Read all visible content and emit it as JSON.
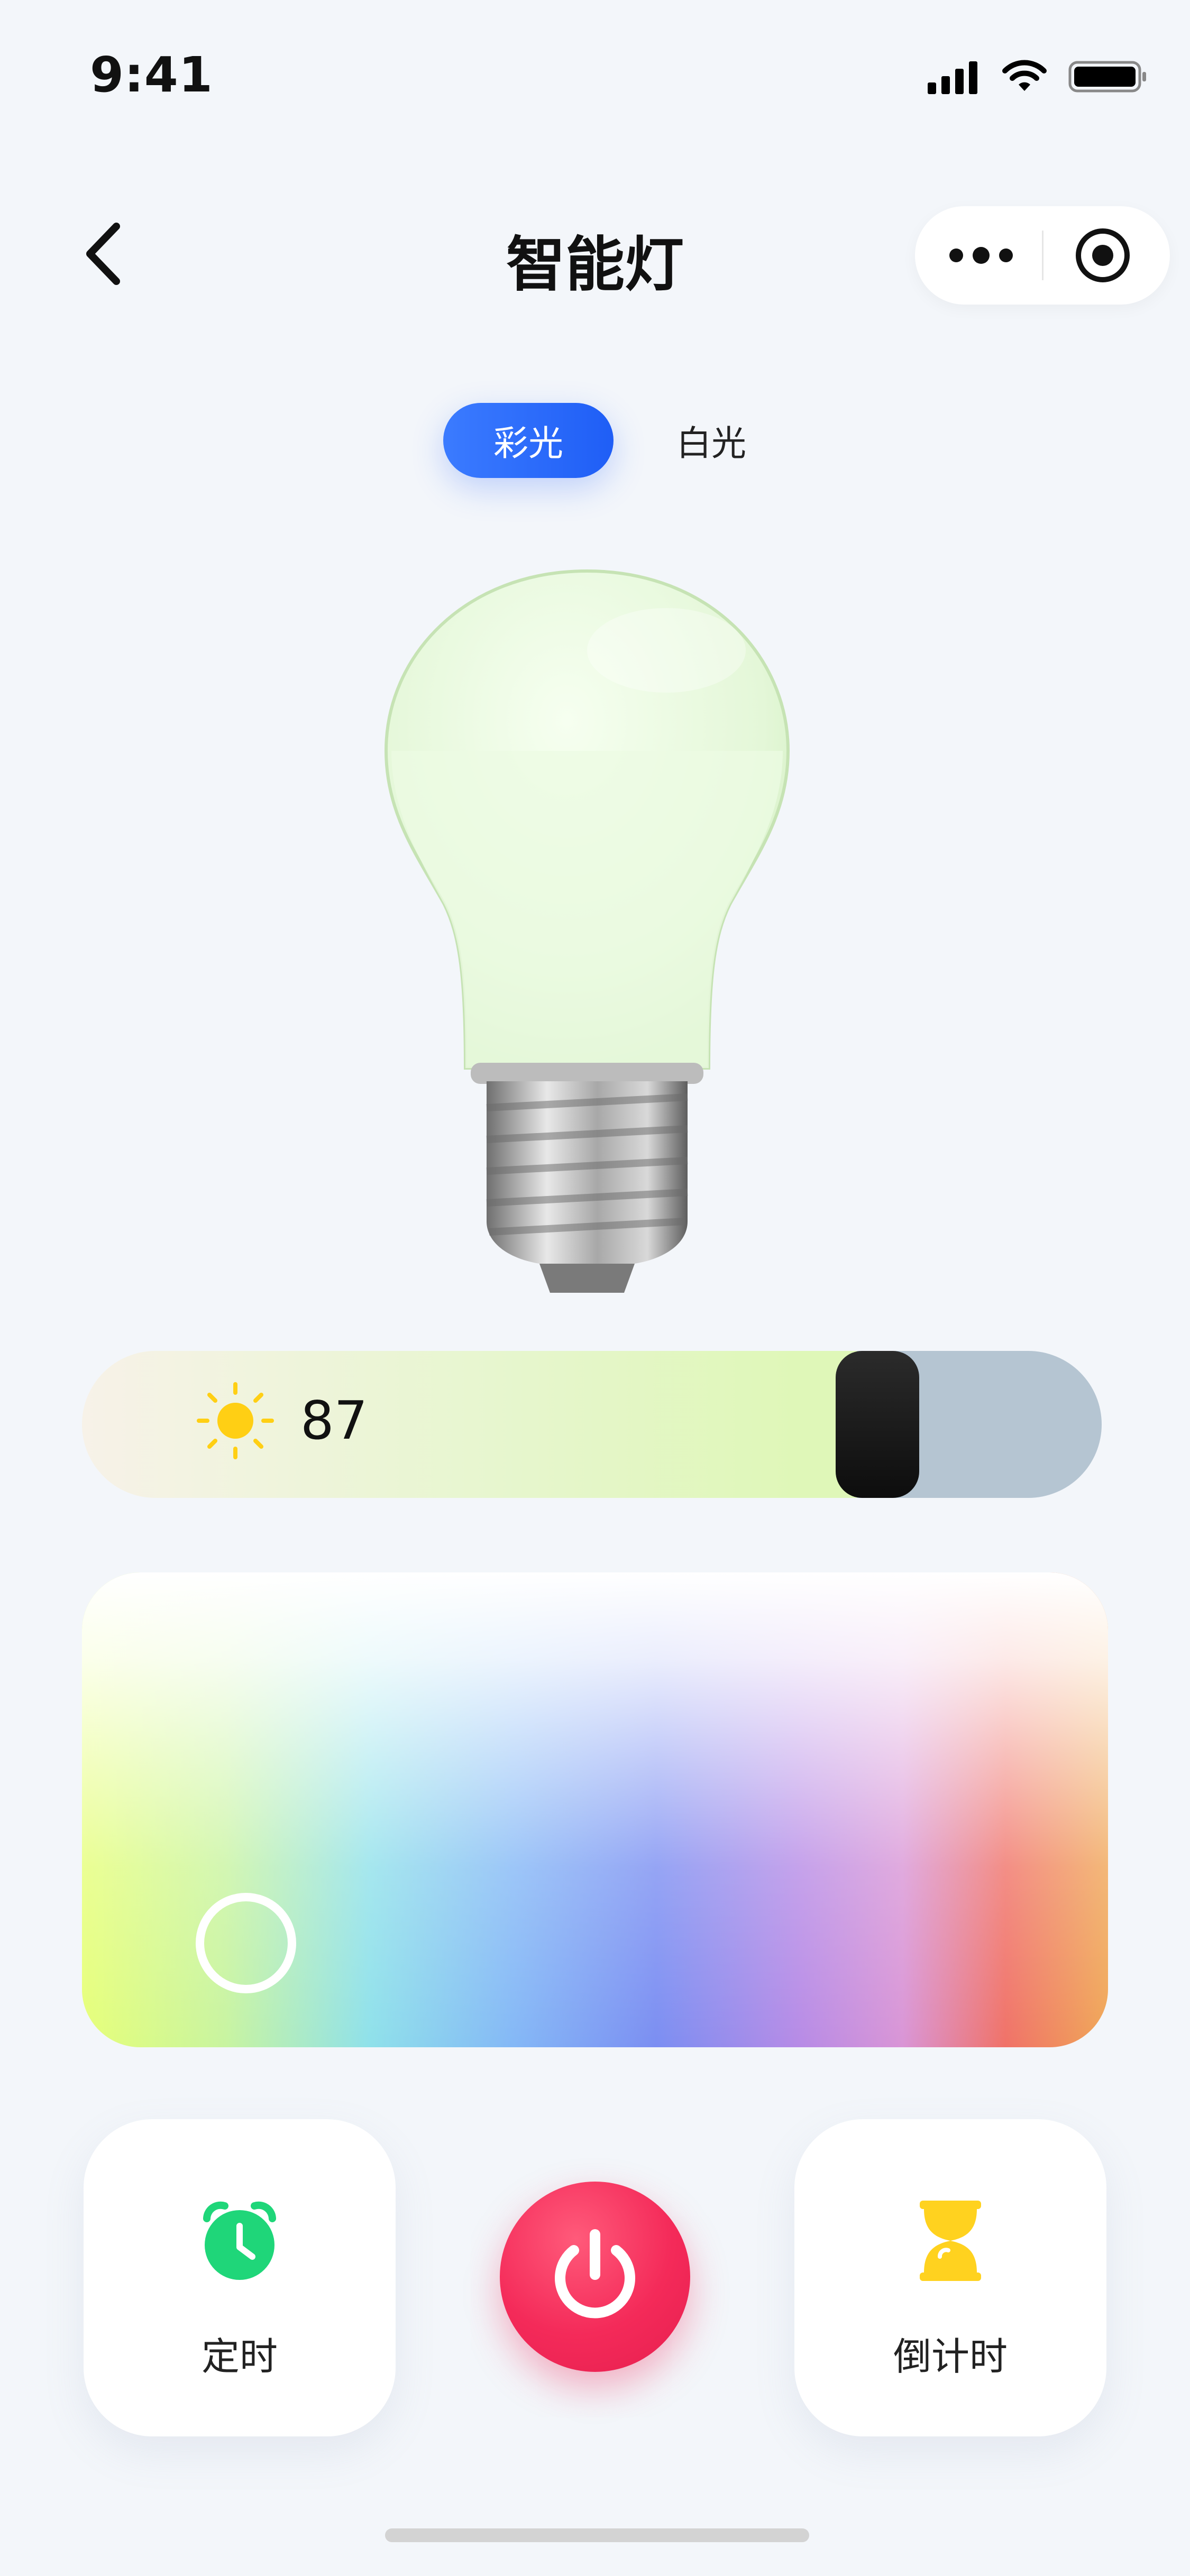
{
  "status_bar": {
    "time": "9:41"
  },
  "nav": {
    "title": "智能灯"
  },
  "mode_tabs": [
    {
      "label": "彩光",
      "active": true
    },
    {
      "label": "白光",
      "active": false
    }
  ],
  "brightness": {
    "value": "87",
    "level": 0.87,
    "icon": "sun-icon"
  },
  "color_picker": {
    "icon": "picker-handle"
  },
  "controls": {
    "timer_label": "定时",
    "countdown_label": "倒计时",
    "power_icon": "power-icon"
  },
  "colors": {
    "accent_blue": "#2a6bff",
    "power_red": "#f42a59",
    "timer_green": "#1fd679",
    "countdown_yellow": "#ffd21f",
    "background": "#f3f6fa"
  }
}
